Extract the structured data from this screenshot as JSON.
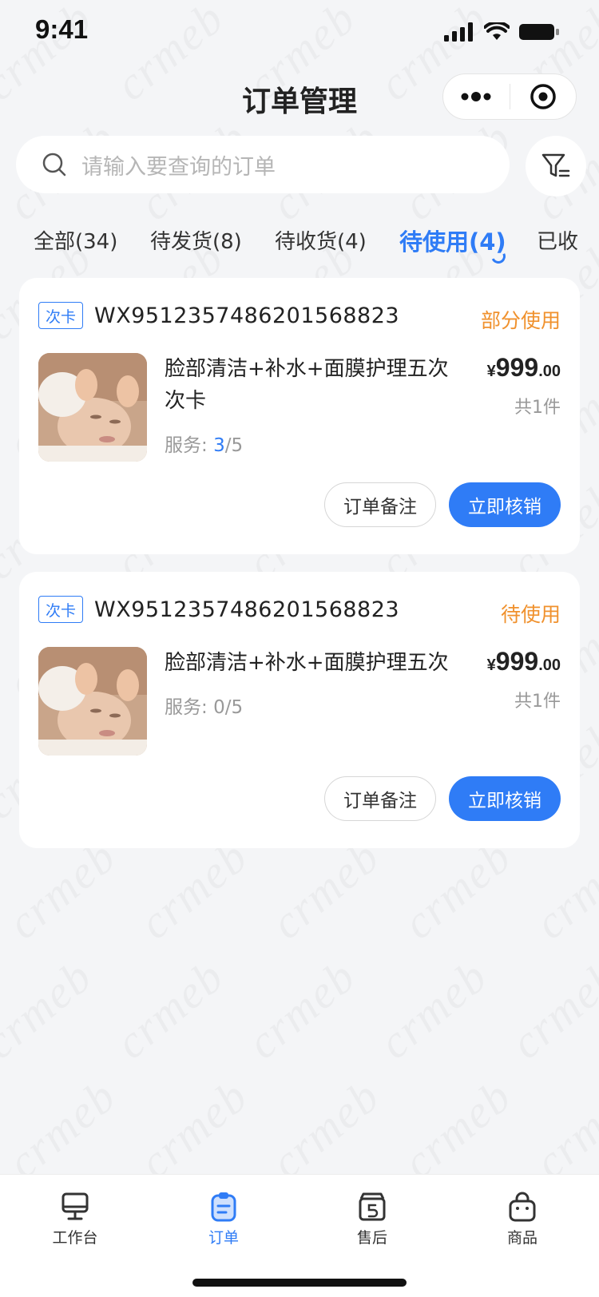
{
  "status_bar": {
    "time": "9:41"
  },
  "nav": {
    "title": "订单管理"
  },
  "search": {
    "placeholder": "请输入要查询的订单"
  },
  "tabs": [
    {
      "label": "全部(34)"
    },
    {
      "label": "待发货(8)"
    },
    {
      "label": "待收货(4)"
    },
    {
      "label": "待使用(4)",
      "active": true
    },
    {
      "label": "已收"
    }
  ],
  "orders": [
    {
      "type_badge": "次卡",
      "order_no": "WX9512357486201568823",
      "status": "部分使用",
      "product_name": "脸部清洁+补水+面膜护理五次次卡",
      "service_label": "服务:",
      "service_used": "3",
      "service_total": "/5",
      "price_symbol": "¥",
      "price_int": "999",
      "price_dec": ".00",
      "quantity": "共1件",
      "remark_button": "订单备注",
      "verify_button": "立即核销"
    },
    {
      "type_badge": "次卡",
      "order_no": "WX9512357486201568823",
      "status": "待使用",
      "product_name": "脸部清洁+补水+面膜护理五次",
      "service_label": "服务:",
      "service_used": "0",
      "service_total": "/5",
      "price_symbol": "¥",
      "price_int": "999",
      "price_dec": ".00",
      "quantity": "共1件",
      "remark_button": "订单备注",
      "verify_button": "立即核销"
    }
  ],
  "tabbar": [
    {
      "label": "工作台",
      "icon": "monitor-icon"
    },
    {
      "label": "订单",
      "icon": "clipboard-icon",
      "active": true
    },
    {
      "label": "售后",
      "icon": "return-box-icon"
    },
    {
      "label": "商品",
      "icon": "shopping-bag-icon"
    }
  ],
  "colors": {
    "accent": "#2f7cf6",
    "status_orange": "#f0912d",
    "background": "#f4f5f7"
  },
  "watermark": "crmeb"
}
